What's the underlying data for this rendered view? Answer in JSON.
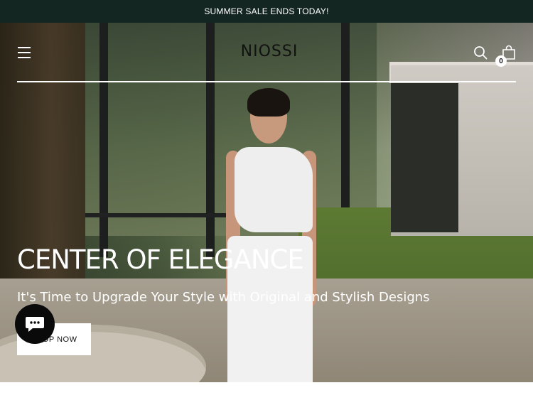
{
  "announcement": {
    "text": "SUMMER SALE ENDS TODAY!"
  },
  "header": {
    "logo": "NIOSSI",
    "menu_icon": "hamburger-menu-icon",
    "search_icon": "search-icon",
    "cart_icon": "shopping-bag-icon",
    "cart_count": "0"
  },
  "hero": {
    "title": "CENTER OF ELEGANCE",
    "subtitle": "It's Time to Upgrade Your Style with Original and Stylish Designs",
    "cta_label": "SHOP NOW"
  },
  "chat": {
    "icon": "chat-bubble-icon"
  },
  "colors": {
    "announcement_bg": "#132622",
    "text_on_dark": "#ffffff",
    "button_bg": "#ffffff",
    "button_text": "#111111"
  }
}
